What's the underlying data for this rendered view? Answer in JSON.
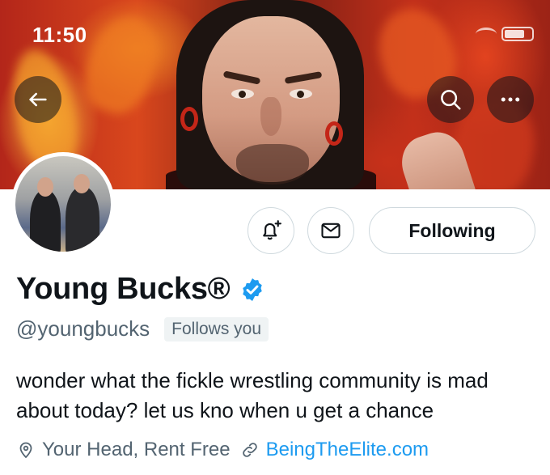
{
  "status_bar": {
    "time": "11:50"
  },
  "header": {
    "back_icon": "arrow-left-icon",
    "search_icon": "search-icon",
    "more_icon": "more-horizontal-icon"
  },
  "profile": {
    "display_name": "Young Bucks®",
    "verified": true,
    "handle": "@youngbucks",
    "follows_you_label": "Follows you",
    "bio": "wonder what the fickle wrestling community is mad about today? let us kno when u get a chance",
    "location": "Your Head, Rent Free",
    "website": "BeingTheElite.com"
  },
  "actions": {
    "notify_icon": "bell-plus-icon",
    "message_icon": "envelope-icon",
    "following_label": "Following"
  },
  "colors": {
    "accent": "#1d9bf0",
    "secondary_text": "#536471",
    "primary_text": "#0f1419",
    "border": "#cfd9de",
    "badge_bg": "#eff3f4"
  }
}
